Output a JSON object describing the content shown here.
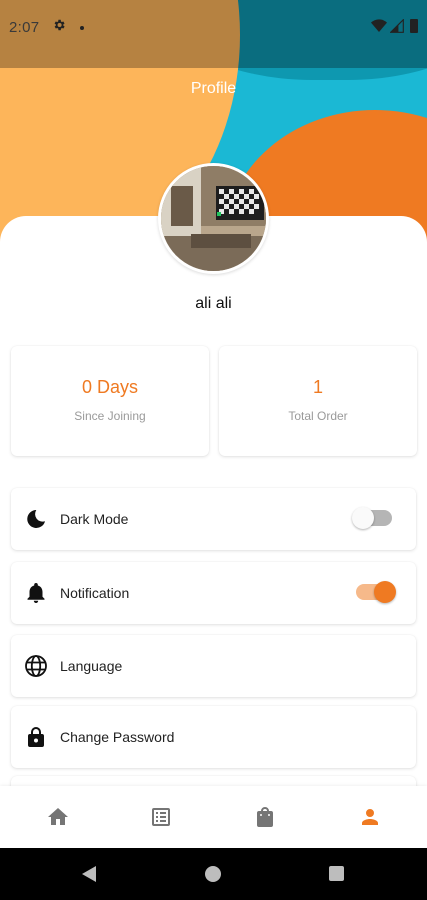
{
  "status_bar": {
    "time": "2:07"
  },
  "header": {
    "title": "Profile"
  },
  "profile": {
    "name": "ali ali"
  },
  "stats": [
    {
      "value": "0 Days",
      "label": "Since Joining"
    },
    {
      "value": "1",
      "label": "Total Order"
    }
  ],
  "settings": [
    {
      "label": "Dark Mode",
      "icon": "moon-icon",
      "toggle": false
    },
    {
      "label": "Notification",
      "icon": "bell-icon",
      "toggle": true
    },
    {
      "label": "Language",
      "icon": "globe-icon"
    },
    {
      "label": "Change Password",
      "icon": "lock-icon"
    }
  ],
  "bottom_nav": {
    "items": [
      {
        "icon": "home-icon",
        "active": false
      },
      {
        "icon": "list-icon",
        "active": false
      },
      {
        "icon": "shopping-bag-icon",
        "active": false
      },
      {
        "icon": "person-icon",
        "active": true
      }
    ]
  },
  "colors": {
    "accent": "#ef7a22",
    "header_teal": "#1bb8d4",
    "header_yellow": "#fdb55a",
    "inactive_icon": "#757575"
  }
}
